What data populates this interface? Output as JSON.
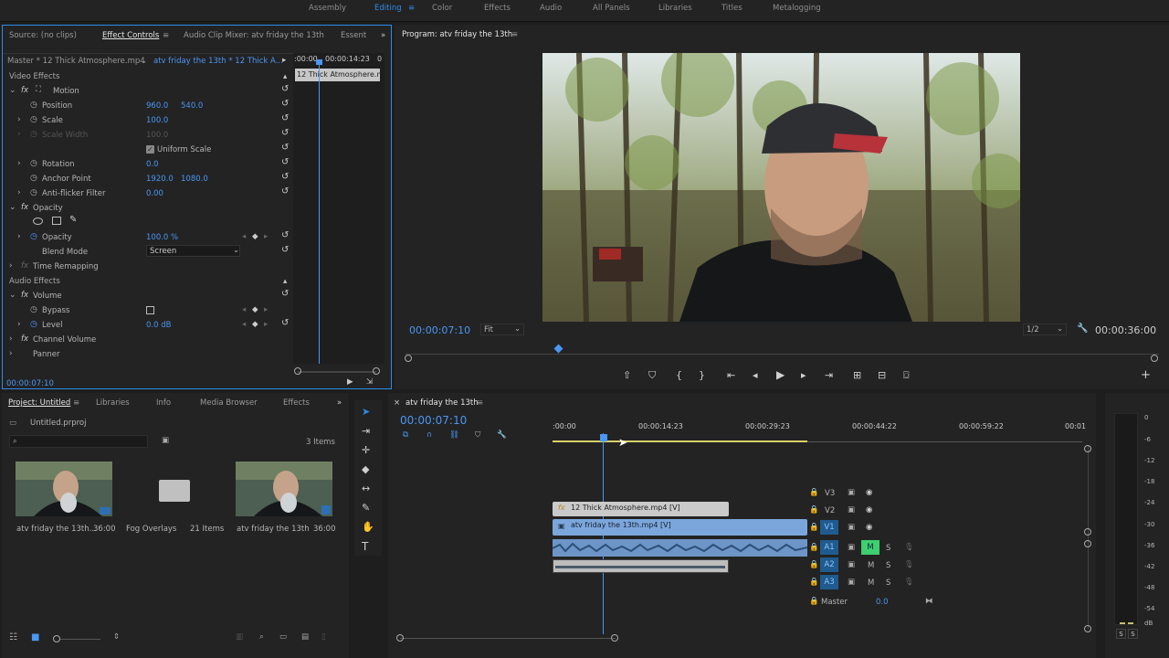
{
  "workspaces": [
    "Assembly",
    "Editing",
    "Color",
    "Effects",
    "Audio",
    "All Panels",
    "Libraries",
    "Titles",
    "Metalogging"
  ],
  "active_workspace": "Editing",
  "effect_panel": {
    "tabs": [
      "Source: (no clips)",
      "Effect Controls",
      "Audio Clip Mixer: atv friday the 13th",
      "Essent"
    ],
    "master": "Master * 12 Thick Atmosphere.mp4",
    "sequence": "atv friday the 13th * 12 Thick A...",
    "mini_time": ":00:00",
    "mini_time2": "00:00:14:23",
    "mini_clip": "12 Thick Atmosphere.m",
    "video_effects": "Video Effects",
    "motion": "Motion",
    "position": "Position",
    "position_x": "960.0",
    "position_y": "540.0",
    "scale": "Scale",
    "scale_val": "100.0",
    "scale_width": "Scale Width",
    "scale_width_val": "100.0",
    "uniform_scale": "Uniform Scale",
    "rotation": "Rotation",
    "rotation_val": "0.0",
    "anchor": "Anchor Point",
    "anchor_x": "1920.0",
    "anchor_y": "1080.0",
    "antiflicker": "Anti-flicker Filter",
    "antiflicker_val": "0.00",
    "opacity_group": "Opacity",
    "opacity": "Opacity",
    "opacity_val": "100.0 %",
    "blend_mode": "Blend Mode",
    "blend_val": "Screen",
    "time_remap": "Time Remapping",
    "audio_effects": "Audio Effects",
    "volume": "Volume",
    "bypass": "Bypass",
    "level": "Level",
    "level_val": "0.0 dB",
    "channel_volume": "Channel Volume",
    "panner": "Panner",
    "timecode": "00:00:07:10"
  },
  "program": {
    "title": "Program: atv friday the 13th",
    "timecode": "00:00:07:10",
    "fit": "Fit",
    "resolution": "1/2",
    "duration": "00:00:36:00"
  },
  "project": {
    "tabs": [
      "Project: Untitled",
      "Libraries",
      "Info",
      "Media Browser",
      "Effects"
    ],
    "file": "Untitled.prproj",
    "items_count": "3 Items",
    "items": [
      {
        "name": "atv friday the 13th...",
        "dur": "36:00"
      },
      {
        "name": "Fog Overlays",
        "dur": "21 Items"
      },
      {
        "name": "atv friday the 13th",
        "dur": "36:00"
      }
    ]
  },
  "timeline": {
    "title": "atv friday the 13th",
    "timecode": "00:00:07:10",
    "ruler": [
      ":00:00",
      "00:00:14:23",
      "00:00:29:23",
      "00:00:44:22",
      "00:00:59:22",
      "00:01"
    ],
    "tracks": [
      "V3",
      "V2",
      "V1",
      "A1",
      "A2",
      "A3"
    ],
    "master": "Master",
    "master_val": "0.0",
    "clip_v2": "12 Thick Atmosphere.mp4 [V]",
    "clip_v1": "atv friday the 13th.mp4 [V]"
  },
  "meter": {
    "ticks": [
      "0",
      "-6",
      "-12",
      "-18",
      "-24",
      "-30",
      "-36",
      "-42",
      "-48",
      "-54",
      "dB"
    ]
  }
}
